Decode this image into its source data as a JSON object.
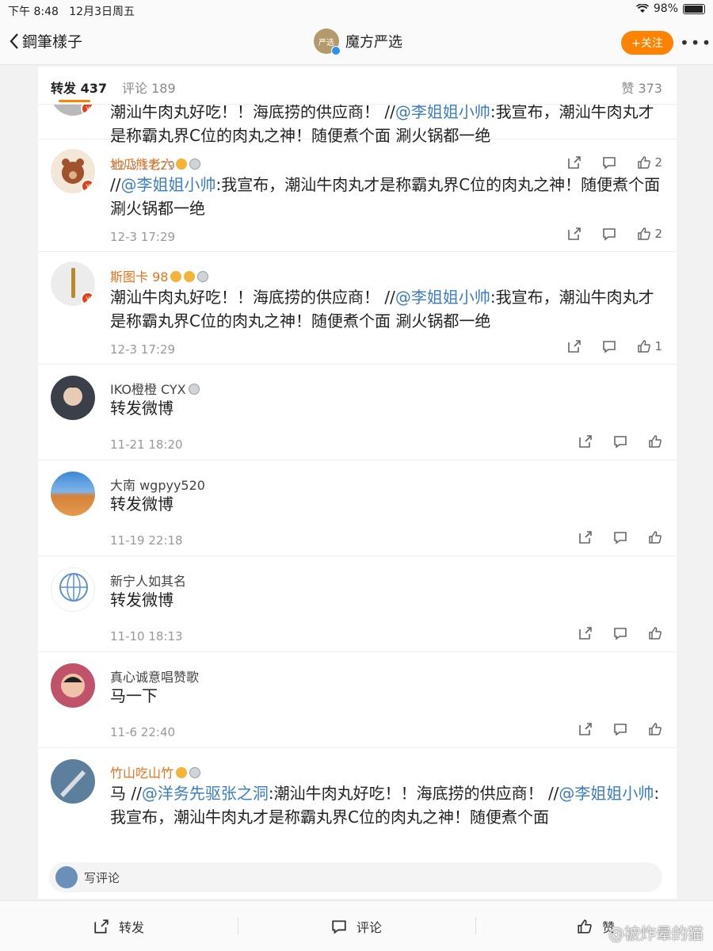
{
  "status_bar": {
    "time": "下午 8:48",
    "date": "12月3日周五",
    "battery": "98%",
    "battery_level": 0.98
  },
  "nav": {
    "back_label": "鋼筆樣子",
    "account_name": "魔方严选",
    "avatar_text": "严选",
    "follow_label": "+关注"
  },
  "tabs": {
    "repost": "转发 437",
    "comment": "评论 189",
    "likes": "赞 373"
  },
  "colors": {
    "accent": "#ff8200",
    "link": "#3b7dc4",
    "vip_name": "#e8721c"
  },
  "items": [
    {
      "name": "",
      "text_parts": [
        [
          "潮汕牛肉丸好吃！！海底捞的供应商！ //",
          false
        ],
        [
          "@李姐姐小帅",
          true
        ],
        [
          ":我宣布，潮汕牛肉丸才是称霸丸界C位的肉丸之神！随便煮个面 涮火锅都一绝",
          false
        ]
      ],
      "time": "12-3 17:29",
      "likes": "2"
    },
    {
      "name": "地瓜熊老六",
      "text_parts": [
        [
          "//",
          false
        ],
        [
          "@李姐姐小帅",
          true
        ],
        [
          ":我宣布，潮汕牛肉丸才是称霸丸界C位的肉丸之神！随便煮个面 涮火锅都一绝",
          false
        ]
      ],
      "time": "12-3 17:29",
      "likes": "2"
    },
    {
      "name": "斯图卡 98",
      "text_parts": [
        [
          "潮汕牛肉丸好吃！！海底捞的供应商！ //",
          false
        ],
        [
          "@李姐姐小帅",
          true
        ],
        [
          ":我宣布，潮汕牛肉丸才是称霸丸界C位的肉丸之神！随便煮个面 涮火锅都一绝",
          false
        ]
      ],
      "time": "12-3 17:29",
      "likes": "1"
    },
    {
      "name": "IKO橙橙 CYX",
      "text_parts": [
        [
          "转发微博",
          false
        ]
      ],
      "time": "11-21 18:20",
      "likes": ""
    },
    {
      "name": "大南 wgpyy520",
      "text_parts": [
        [
          "转发微博",
          false
        ]
      ],
      "time": "11-19 22:18",
      "likes": ""
    },
    {
      "name": "新宁人如其名",
      "text_parts": [
        [
          "转发微博",
          false
        ]
      ],
      "time": "11-10 18:13",
      "likes": ""
    },
    {
      "name": "真心诚意唱赞歌",
      "text_parts": [
        [
          "马一下",
          false
        ]
      ],
      "time": "11-6 22:40",
      "likes": ""
    },
    {
      "name": "竹山吃山竹",
      "text_parts": [
        [
          "马 //",
          false
        ],
        [
          "@洋务先驱张之洞",
          true
        ],
        [
          ":潮汕牛肉丸好吃！！海底捞的供应商！ //",
          false
        ],
        [
          "@李姐姐小帅",
          true
        ],
        [
          ":我宣布，潮汕牛肉丸才是称霸丸界C位的肉丸之神！随便煮个面",
          false
        ]
      ],
      "time": "",
      "likes": ""
    }
  ],
  "write_comment": "写评论",
  "bottom_bar": {
    "repost": "转发",
    "comment": "评论",
    "like": "赞"
  },
  "watermark": "@被炸晕的猫"
}
